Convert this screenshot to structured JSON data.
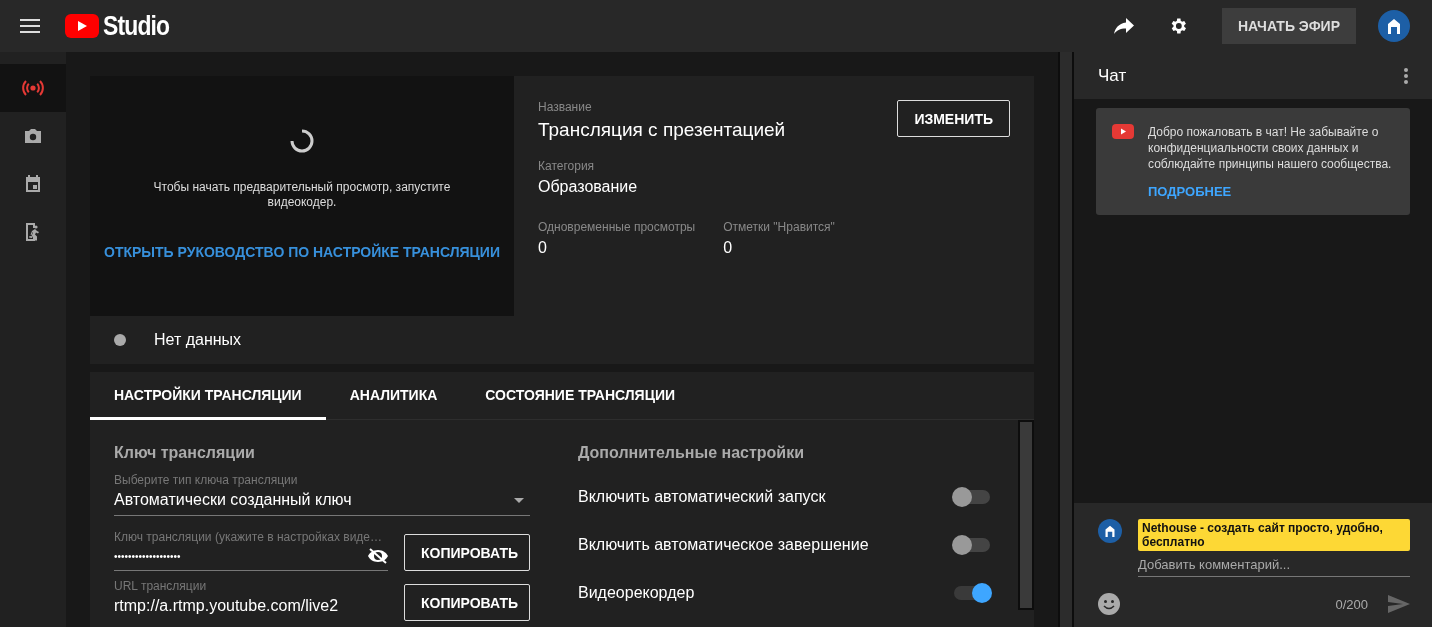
{
  "header": {
    "logo_text": "Studio",
    "start_button": "НАЧАТЬ ЭФИР"
  },
  "rail": [
    {
      "kind": "live",
      "selected": true
    },
    {
      "kind": "camera",
      "selected": false
    },
    {
      "kind": "calendar",
      "selected": false
    },
    {
      "kind": "exit",
      "selected": false
    }
  ],
  "preview": {
    "message": "Чтобы начать предварительный просмотр, запустите видеокодер.",
    "guide_link": "ОТКРЫТЬ РУКОВОДСТВО ПО НАСТРОЙКЕ ТРАНСЛЯЦИИ"
  },
  "stream_info": {
    "title_label": "Название",
    "title": "Трансляция с презентацией",
    "edit_button": "ИЗМЕНИТЬ",
    "category_label": "Категория",
    "category": "Образование",
    "stats": [
      {
        "label": "Одновременные просмотры",
        "value": "0"
      },
      {
        "label": "Отметки \"Нравится\"",
        "value": "0"
      }
    ]
  },
  "status": {
    "text": "Нет данных"
  },
  "tabs": [
    {
      "label": "НАСТРОЙКИ ТРАНСЛЯЦИИ",
      "selected": true
    },
    {
      "label": "АНАЛИТИКА",
      "selected": false
    },
    {
      "label": "СОСТОЯНИЕ ТРАНСЛЯЦИИ",
      "selected": false
    }
  ],
  "stream_key": {
    "heading": "Ключ трансляции",
    "type_label": "Выберите тип ключа трансляции",
    "type_value": "Автоматически созданный ключ",
    "key_label": "Ключ трансляции (укажите в настройках виде…",
    "key_value": "•••••••••••••••••••",
    "key_copy_button": "КОПИРОВАТЬ",
    "url_label": "URL трансляции",
    "url_value": "rtmp://a.rtmp.youtube.com/live2",
    "url_copy_button": "КОПИРОВАТЬ"
  },
  "extra": {
    "heading": "Дополнительные настройки",
    "toggles": [
      {
        "label": "Включить автоматический запуск",
        "on": false
      },
      {
        "label": "Включить автоматическое завершение",
        "on": false
      },
      {
        "label": "Видеорекордер",
        "on": true
      }
    ]
  },
  "chat": {
    "title": "Чат",
    "welcome": "Добро пожаловать в чат! Не забывайте о конфиденциальности своих данных и соблюдайте принципы нашего сообщества.",
    "more_link": "ПОДРОБНЕЕ",
    "author": "Nethouse - создать сайт просто, удобно, бесплатно",
    "placeholder": "Добавить комментарий...",
    "counter": "0/200"
  }
}
